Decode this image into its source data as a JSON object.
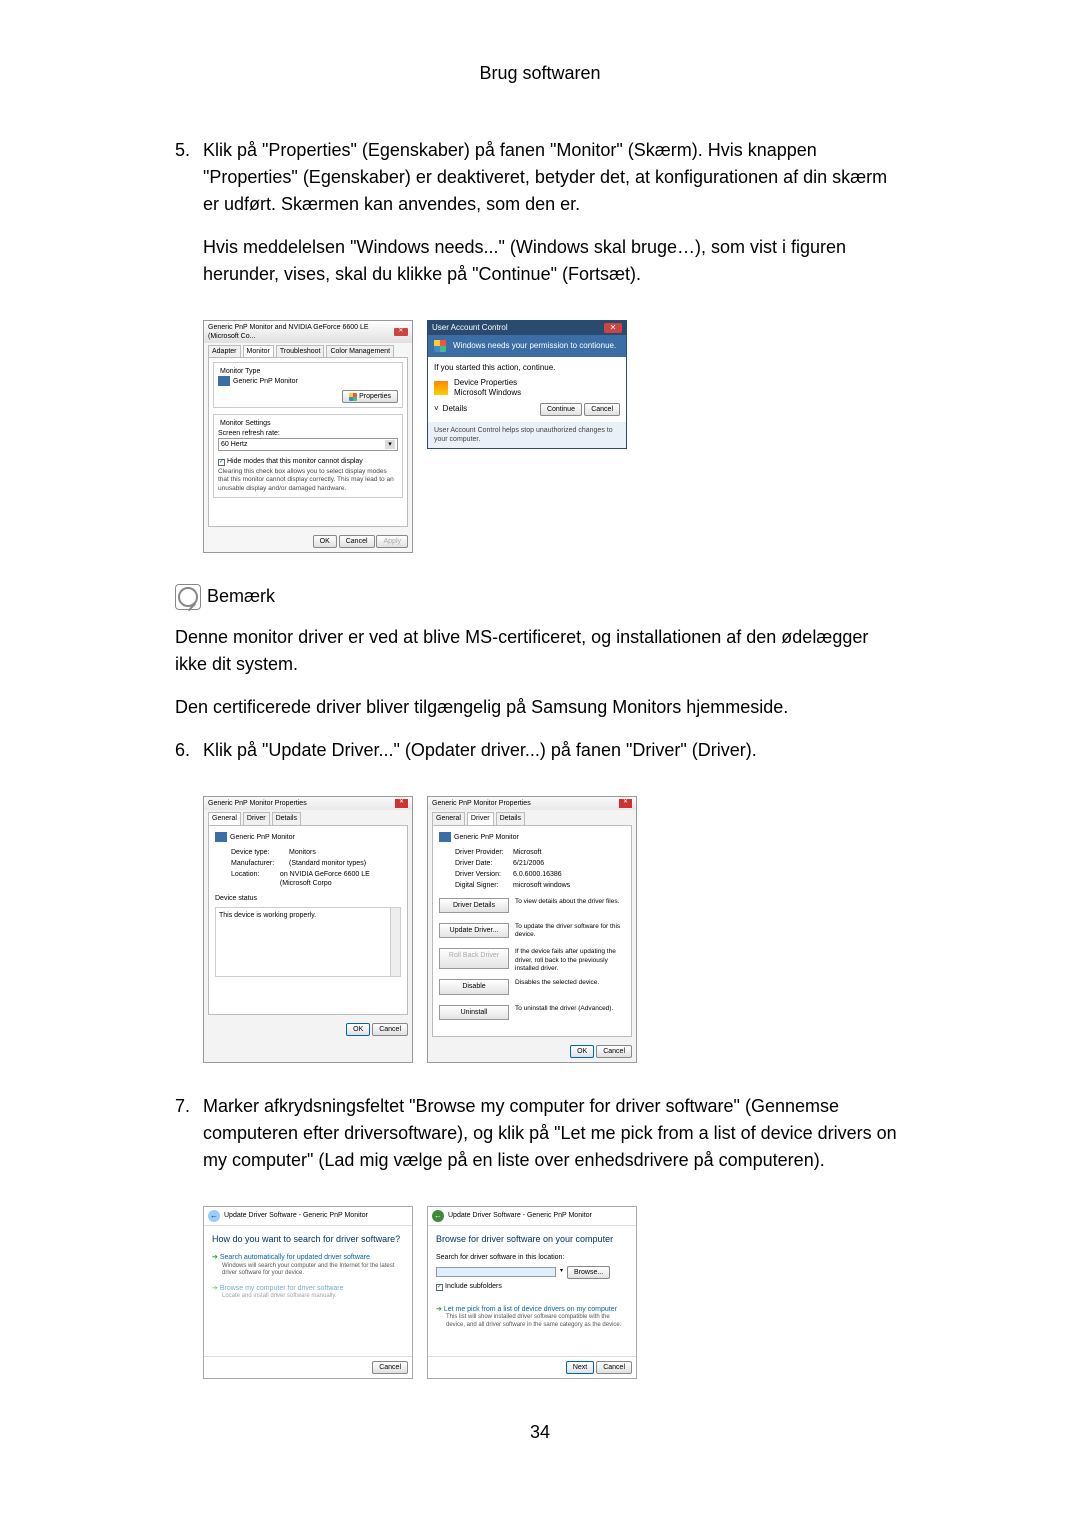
{
  "header": "Brug softwaren",
  "step5": {
    "num": "5.",
    "text1": "Klik på \"Properties\" (Egenskaber) på fanen \"Monitor\" (Skærm). Hvis knappen \"Properties\" (Egenskaber) er deaktiveret, betyder det, at konfigurationen af din skærm er udført. Skærmen kan anvendes, som den er.",
    "text2": "Hvis meddelelsen \"Windows needs...\" (Windows skal bruge…), som vist i figuren herunder, vises, skal du klikke på \"Continue\" (Fortsæt)."
  },
  "dlgA": {
    "title": "Generic PnP Monitor and NVIDIA GeForce 6600 LE (Microsoft Co...",
    "tabs": [
      "Adapter",
      "Monitor",
      "Troubleshoot",
      "Color Management"
    ],
    "monitorType": "Monitor Type",
    "monitorName": "Generic PnP Monitor",
    "propertiesBtn": "Properties",
    "monitorSettings": "Monitor Settings",
    "refreshLabel": "Screen refresh rate:",
    "refreshVal": "60 Hertz",
    "hideModesCb": "Hide modes that this monitor cannot display",
    "hideModesDesc": "Clearing this check box allows you to select display modes that this monitor cannot display correctly. This may lead to an unusable display and/or damaged hardware.",
    "ok": "OK",
    "cancel": "Cancel",
    "apply": "Apply"
  },
  "dlgB": {
    "title": "User Account Control",
    "banner": "Windows needs your permission to contionue.",
    "ifyou": "If you started this action, continue.",
    "devprop": "Device Properties",
    "mswin": "Microsoft Windows",
    "details": "Details",
    "continue": "Continue",
    "cancel": "Cancel",
    "foot": "User Account Control helps stop unauthorized changes to your computer."
  },
  "note": {
    "label": "Bemærk",
    "p1": "Denne monitor driver er ved at blive MS-certificeret, og installationen af den ødelægger ikke dit system.",
    "p2": "Den certificerede driver bliver tilgængelig på Samsung Monitors hjemmeside."
  },
  "step6": {
    "num": "6.",
    "text": "Klik på \"Update Driver...\" (Opdater driver...) på fanen \"Driver\" (Driver)."
  },
  "dlgC": {
    "title": "Generic PnP Monitor Properties",
    "tabsGeneral": [
      "General",
      "Driver",
      "Details"
    ],
    "devname": "Generic PnP Monitor",
    "dtype": {
      "k": "Device type:",
      "v": "Monitors"
    },
    "manuf": {
      "k": "Manufacturer:",
      "v": "(Standard monitor types)"
    },
    "loc": {
      "k": "Location:",
      "v": "on NVIDIA GeForce 6600 LE (Microsoft Corpo"
    },
    "devstatus": "Device status",
    "working": "This device is working properly.",
    "ok": "OK",
    "cancel": "Cancel"
  },
  "dlgD": {
    "driverProvider": {
      "k": "Driver Provider:",
      "v": "Microsoft"
    },
    "driverDate": {
      "k": "Driver Date:",
      "v": "6/21/2006"
    },
    "driverVersion": {
      "k": "Driver Version:",
      "v": "6.0.6000.16386"
    },
    "digitalSigner": {
      "k": "Digital Signer:",
      "v": "microsoft windows"
    },
    "btns": {
      "details": {
        "label": "Driver Details",
        "desc": "To view details about the driver files."
      },
      "update": {
        "label": "Update Driver...",
        "desc": "To update the driver software for this device."
      },
      "rollback": {
        "label": "Roll Back Driver",
        "desc": "If the device fails after updating the driver, roll back to the previously installed driver."
      },
      "disable": {
        "label": "Disable",
        "desc": "Disables the selected device."
      },
      "uninstall": {
        "label": "Uninstall",
        "desc": "To uninstall the driver (Advanced)."
      }
    }
  },
  "step7": {
    "num": "7.",
    "text": "Marker afkrydsningsfeltet \"Browse my computer for driver software\" (Gennemse computeren efter driversoftware), og klik på \"Let me pick from a list of device drivers on my computer\" (Lad mig vælge på en liste over enhedsdrivere på computeren)."
  },
  "wizA": {
    "bread": "Update Driver Software - Generic PnP Monitor",
    "heading": "How do you want to search for driver software?",
    "opt1": "Search automatically for updated driver software",
    "opt1sub": "Windows will search your computer and the Internet for the latest driver software for your device.",
    "opt2": "Browse my computer for driver software",
    "opt2sub": "Locate and install driver software manually.",
    "cancel": "Cancel"
  },
  "wizB": {
    "bread": "Update Driver Software - Generic PnP Monitor",
    "heading": "Browse for driver software on your computer",
    "searchLabel": "Search for driver software in this location:",
    "browse": "Browse...",
    "includeSub": "Include subfolders",
    "opt": "Let me pick from a list of device drivers on my computer",
    "optsub": "This list will show installed driver software compatible with the device, and all driver software in the same category as the device.",
    "next": "Next",
    "cancel": "Cancel"
  },
  "pagenum": "34"
}
